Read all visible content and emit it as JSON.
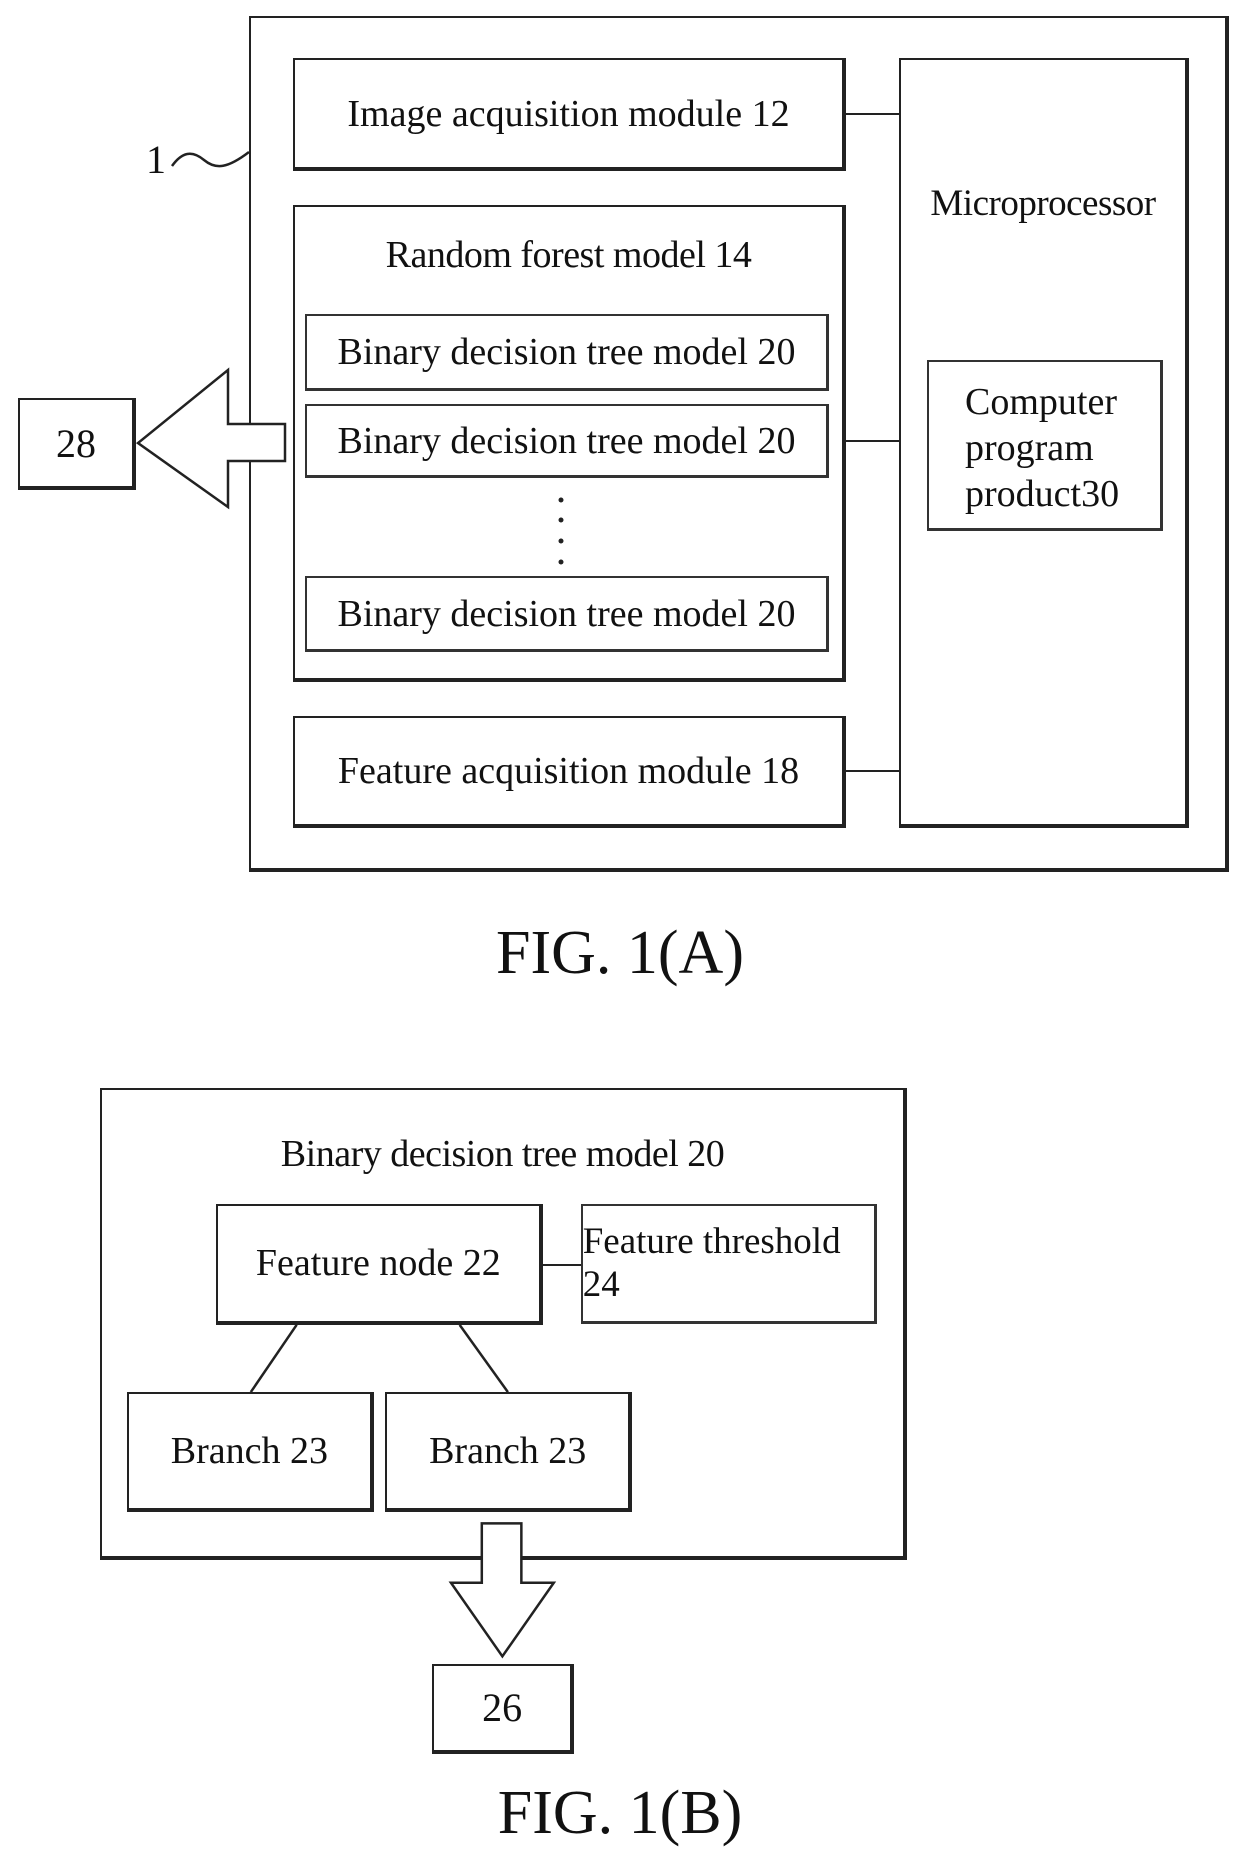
{
  "fig_a": {
    "caption": "FIG. 1(A)",
    "system_ref": "1",
    "output_ref": "28",
    "image_acquisition": "Image acquisition module 12",
    "random_forest": {
      "title": "Random forest model 14",
      "trees": [
        "Binary decision tree model 20",
        "Binary decision tree model 20",
        "Binary decision tree model 20"
      ],
      "ellipsis": "⋮"
    },
    "feature_acquisition": "Feature acquisition module 18",
    "microprocessor": "Microprocessor",
    "computer_program": [
      "Computer",
      "program",
      "product30"
    ]
  },
  "fig_b": {
    "caption": "FIG. 1(B)",
    "title": "Binary decision tree model 20",
    "feature_node": "Feature node 22",
    "feature_threshold": "Feature threshold 24",
    "branches": [
      "Branch 23",
      "Branch 23"
    ],
    "output_ref": "26"
  }
}
